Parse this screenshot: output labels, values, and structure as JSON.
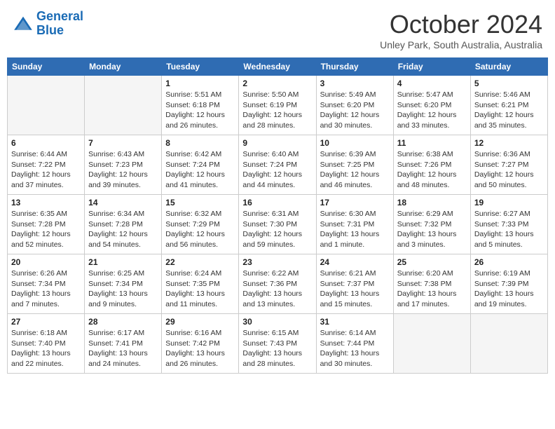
{
  "logo": {
    "line1": "General",
    "line2": "Blue"
  },
  "title": "October 2024",
  "subtitle": "Unley Park, South Australia, Australia",
  "days_of_week": [
    "Sunday",
    "Monday",
    "Tuesday",
    "Wednesday",
    "Thursday",
    "Friday",
    "Saturday"
  ],
  "weeks": [
    [
      {
        "day": "",
        "info": ""
      },
      {
        "day": "",
        "info": ""
      },
      {
        "day": "1",
        "sunrise": "5:51 AM",
        "sunset": "6:18 PM",
        "daylight": "12 hours and 26 minutes."
      },
      {
        "day": "2",
        "sunrise": "5:50 AM",
        "sunset": "6:19 PM",
        "daylight": "12 hours and 28 minutes."
      },
      {
        "day": "3",
        "sunrise": "5:49 AM",
        "sunset": "6:20 PM",
        "daylight": "12 hours and 30 minutes."
      },
      {
        "day": "4",
        "sunrise": "5:47 AM",
        "sunset": "6:20 PM",
        "daylight": "12 hours and 33 minutes."
      },
      {
        "day": "5",
        "sunrise": "5:46 AM",
        "sunset": "6:21 PM",
        "daylight": "12 hours and 35 minutes."
      }
    ],
    [
      {
        "day": "6",
        "sunrise": "6:44 AM",
        "sunset": "7:22 PM",
        "daylight": "12 hours and 37 minutes."
      },
      {
        "day": "7",
        "sunrise": "6:43 AM",
        "sunset": "7:23 PM",
        "daylight": "12 hours and 39 minutes."
      },
      {
        "day": "8",
        "sunrise": "6:42 AM",
        "sunset": "7:24 PM",
        "daylight": "12 hours and 41 minutes."
      },
      {
        "day": "9",
        "sunrise": "6:40 AM",
        "sunset": "7:24 PM",
        "daylight": "12 hours and 44 minutes."
      },
      {
        "day": "10",
        "sunrise": "6:39 AM",
        "sunset": "7:25 PM",
        "daylight": "12 hours and 46 minutes."
      },
      {
        "day": "11",
        "sunrise": "6:38 AM",
        "sunset": "7:26 PM",
        "daylight": "12 hours and 48 minutes."
      },
      {
        "day": "12",
        "sunrise": "6:36 AM",
        "sunset": "7:27 PM",
        "daylight": "12 hours and 50 minutes."
      }
    ],
    [
      {
        "day": "13",
        "sunrise": "6:35 AM",
        "sunset": "7:28 PM",
        "daylight": "12 hours and 52 minutes."
      },
      {
        "day": "14",
        "sunrise": "6:34 AM",
        "sunset": "7:28 PM",
        "daylight": "12 hours and 54 minutes."
      },
      {
        "day": "15",
        "sunrise": "6:32 AM",
        "sunset": "7:29 PM",
        "daylight": "12 hours and 56 minutes."
      },
      {
        "day": "16",
        "sunrise": "6:31 AM",
        "sunset": "7:30 PM",
        "daylight": "12 hours and 59 minutes."
      },
      {
        "day": "17",
        "sunrise": "6:30 AM",
        "sunset": "7:31 PM",
        "daylight": "13 hours and 1 minute."
      },
      {
        "day": "18",
        "sunrise": "6:29 AM",
        "sunset": "7:32 PM",
        "daylight": "13 hours and 3 minutes."
      },
      {
        "day": "19",
        "sunrise": "6:27 AM",
        "sunset": "7:33 PM",
        "daylight": "13 hours and 5 minutes."
      }
    ],
    [
      {
        "day": "20",
        "sunrise": "6:26 AM",
        "sunset": "7:34 PM",
        "daylight": "13 hours and 7 minutes."
      },
      {
        "day": "21",
        "sunrise": "6:25 AM",
        "sunset": "7:34 PM",
        "daylight": "13 hours and 9 minutes."
      },
      {
        "day": "22",
        "sunrise": "6:24 AM",
        "sunset": "7:35 PM",
        "daylight": "13 hours and 11 minutes."
      },
      {
        "day": "23",
        "sunrise": "6:22 AM",
        "sunset": "7:36 PM",
        "daylight": "13 hours and 13 minutes."
      },
      {
        "day": "24",
        "sunrise": "6:21 AM",
        "sunset": "7:37 PM",
        "daylight": "13 hours and 15 minutes."
      },
      {
        "day": "25",
        "sunrise": "6:20 AM",
        "sunset": "7:38 PM",
        "daylight": "13 hours and 17 minutes."
      },
      {
        "day": "26",
        "sunrise": "6:19 AM",
        "sunset": "7:39 PM",
        "daylight": "13 hours and 19 minutes."
      }
    ],
    [
      {
        "day": "27",
        "sunrise": "6:18 AM",
        "sunset": "7:40 PM",
        "daylight": "13 hours and 22 minutes."
      },
      {
        "day": "28",
        "sunrise": "6:17 AM",
        "sunset": "7:41 PM",
        "daylight": "13 hours and 24 minutes."
      },
      {
        "day": "29",
        "sunrise": "6:16 AM",
        "sunset": "7:42 PM",
        "daylight": "13 hours and 26 minutes."
      },
      {
        "day": "30",
        "sunrise": "6:15 AM",
        "sunset": "7:43 PM",
        "daylight": "13 hours and 28 minutes."
      },
      {
        "day": "31",
        "sunrise": "6:14 AM",
        "sunset": "7:44 PM",
        "daylight": "13 hours and 30 minutes."
      },
      {
        "day": "",
        "info": ""
      },
      {
        "day": "",
        "info": ""
      }
    ]
  ],
  "labels": {
    "sunrise": "Sunrise:",
    "sunset": "Sunset:",
    "daylight": "Daylight:"
  }
}
